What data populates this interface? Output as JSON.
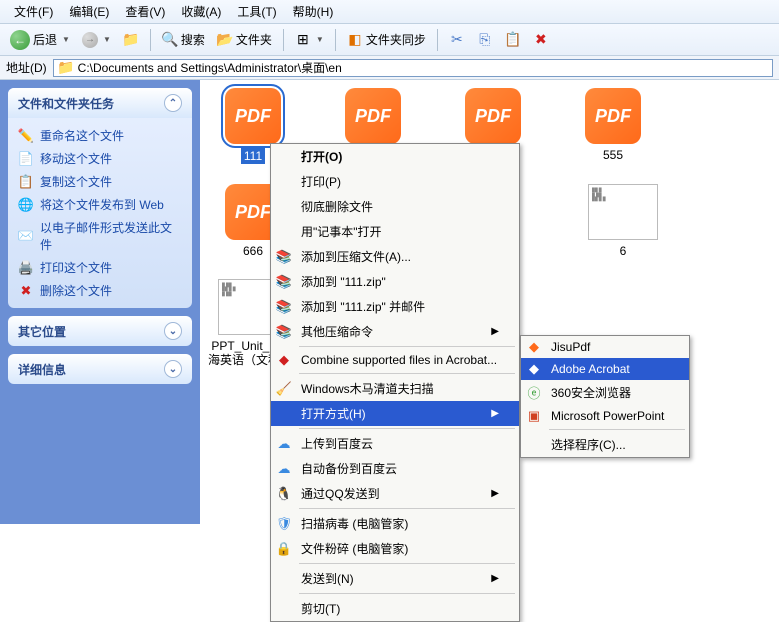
{
  "menubar": {
    "file": "文件(F)",
    "edit": "编辑(E)",
    "view": "查看(V)",
    "fav": "收藏(A)",
    "tools": "工具(T)",
    "help": "帮助(H)"
  },
  "toolbar": {
    "back": "后退",
    "search": "搜索",
    "folders": "文件夹",
    "sync": "文件夹同步"
  },
  "addr": {
    "label": "地址(D)",
    "path": "C:\\Documents and Settings\\Administrator\\桌面\\en"
  },
  "sidebar": {
    "tasks_title": "文件和文件夹任务",
    "tasks": [
      {
        "icon": "✏️",
        "label": "重命名这个文件"
      },
      {
        "icon": "📄",
        "label": "移动这个文件"
      },
      {
        "icon": "📋",
        "label": "复制这个文件"
      },
      {
        "icon": "🌐",
        "label": "将这个文件发布到 Web"
      },
      {
        "icon": "✉️",
        "label": "以电子邮件形式发送此文件"
      },
      {
        "icon": "🖨️",
        "label": "打印这个文件"
      },
      {
        "icon": "✖",
        "label": "删除这个文件"
      }
    ],
    "other_title": "其它位置",
    "detail_title": "详细信息"
  },
  "files": {
    "f1": "111",
    "f2": "",
    "f3": "",
    "f4": "555",
    "f5": "666",
    "p1": "PPT_Un",
    "p2": "6",
    "p3": "PPT_Unit_6_涉海英语（文科卷）"
  },
  "ctx": {
    "open": "打开(O)",
    "print": "打印(P)",
    "del": "彻底删除文件",
    "notepad": "用\"记事本\"打开",
    "zip1": "添加到压缩文件(A)...",
    "zip2": "添加到 \"111.zip\"",
    "zip3": "添加到 \"111.zip\" 并邮件",
    "zip4": "其他压缩命令",
    "combine": "Combine supported files in Acrobat...",
    "scan": "Windows木马清道夫扫描",
    "openwith": "打开方式(H)",
    "baidu1": "上传到百度云",
    "baidu2": "自动备份到百度云",
    "qq": "通过QQ发送到",
    "virus": "扫描病毒 (电脑管家)",
    "shred": "文件粉碎 (电脑管家)",
    "sendto": "发送到(N)",
    "cut": "剪切(T)"
  },
  "sub": {
    "jisu": "JisuPdf",
    "acrobat": "Adobe Acrobat",
    "browser": "360安全浏览器",
    "ppt": "Microsoft PowerPoint",
    "choose": "选择程序(C)..."
  }
}
